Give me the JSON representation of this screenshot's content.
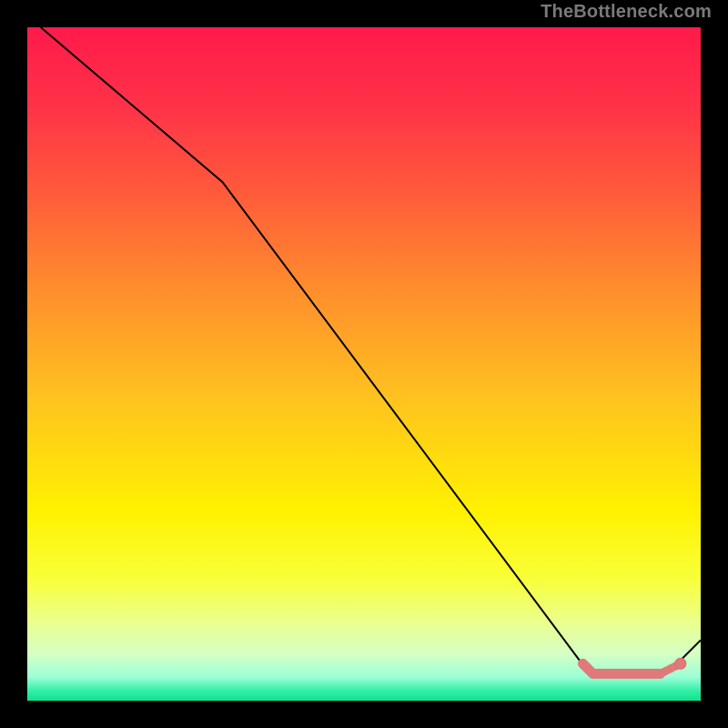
{
  "attribution": "TheBottleneck.com",
  "colors": {
    "frame": "#000000",
    "gradient_stops": [
      {
        "offset": 0.0,
        "color": "#ff1a4a"
      },
      {
        "offset": 0.12,
        "color": "#ff3348"
      },
      {
        "offset": 0.25,
        "color": "#ff5c3a"
      },
      {
        "offset": 0.38,
        "color": "#ff8a2e"
      },
      {
        "offset": 0.55,
        "color": "#ffc21f"
      },
      {
        "offset": 0.72,
        "color": "#fff200"
      },
      {
        "offset": 0.82,
        "color": "#f8ff3a"
      },
      {
        "offset": 0.88,
        "color": "#ecff89"
      },
      {
        "offset": 0.93,
        "color": "#d6ffc4"
      },
      {
        "offset": 0.965,
        "color": "#9bffd6"
      },
      {
        "offset": 0.985,
        "color": "#32f0a8"
      },
      {
        "offset": 1.0,
        "color": "#0fe18e"
      }
    ],
    "line": "#000000",
    "marker_fill": "#e07a7a",
    "marker_stroke": "#d86a6a"
  },
  "chart_data": {
    "type": "line",
    "title": "",
    "xlabel": "",
    "ylabel": "",
    "xlim": [
      0,
      100
    ],
    "ylim": [
      0,
      100
    ],
    "grid": false,
    "legend": false,
    "series": [
      {
        "name": "curve",
        "points": [
          {
            "x": 2,
            "y": 100
          },
          {
            "x": 29,
            "y": 77
          },
          {
            "x": 82,
            "y": 6
          },
          {
            "x": 84,
            "y": 4
          },
          {
            "x": 95,
            "y": 4
          },
          {
            "x": 100,
            "y": 9
          }
        ]
      }
    ],
    "markers_cluster": {
      "note": "Highlighted segment near minimum (thick pink line + endpoint dot)",
      "thick_line": [
        {
          "x": 82.5,
          "y": 5.5
        },
        {
          "x": 84,
          "y": 4
        },
        {
          "x": 94,
          "y": 4
        }
      ],
      "endpoint": {
        "x": 97,
        "y": 5.5
      }
    }
  }
}
